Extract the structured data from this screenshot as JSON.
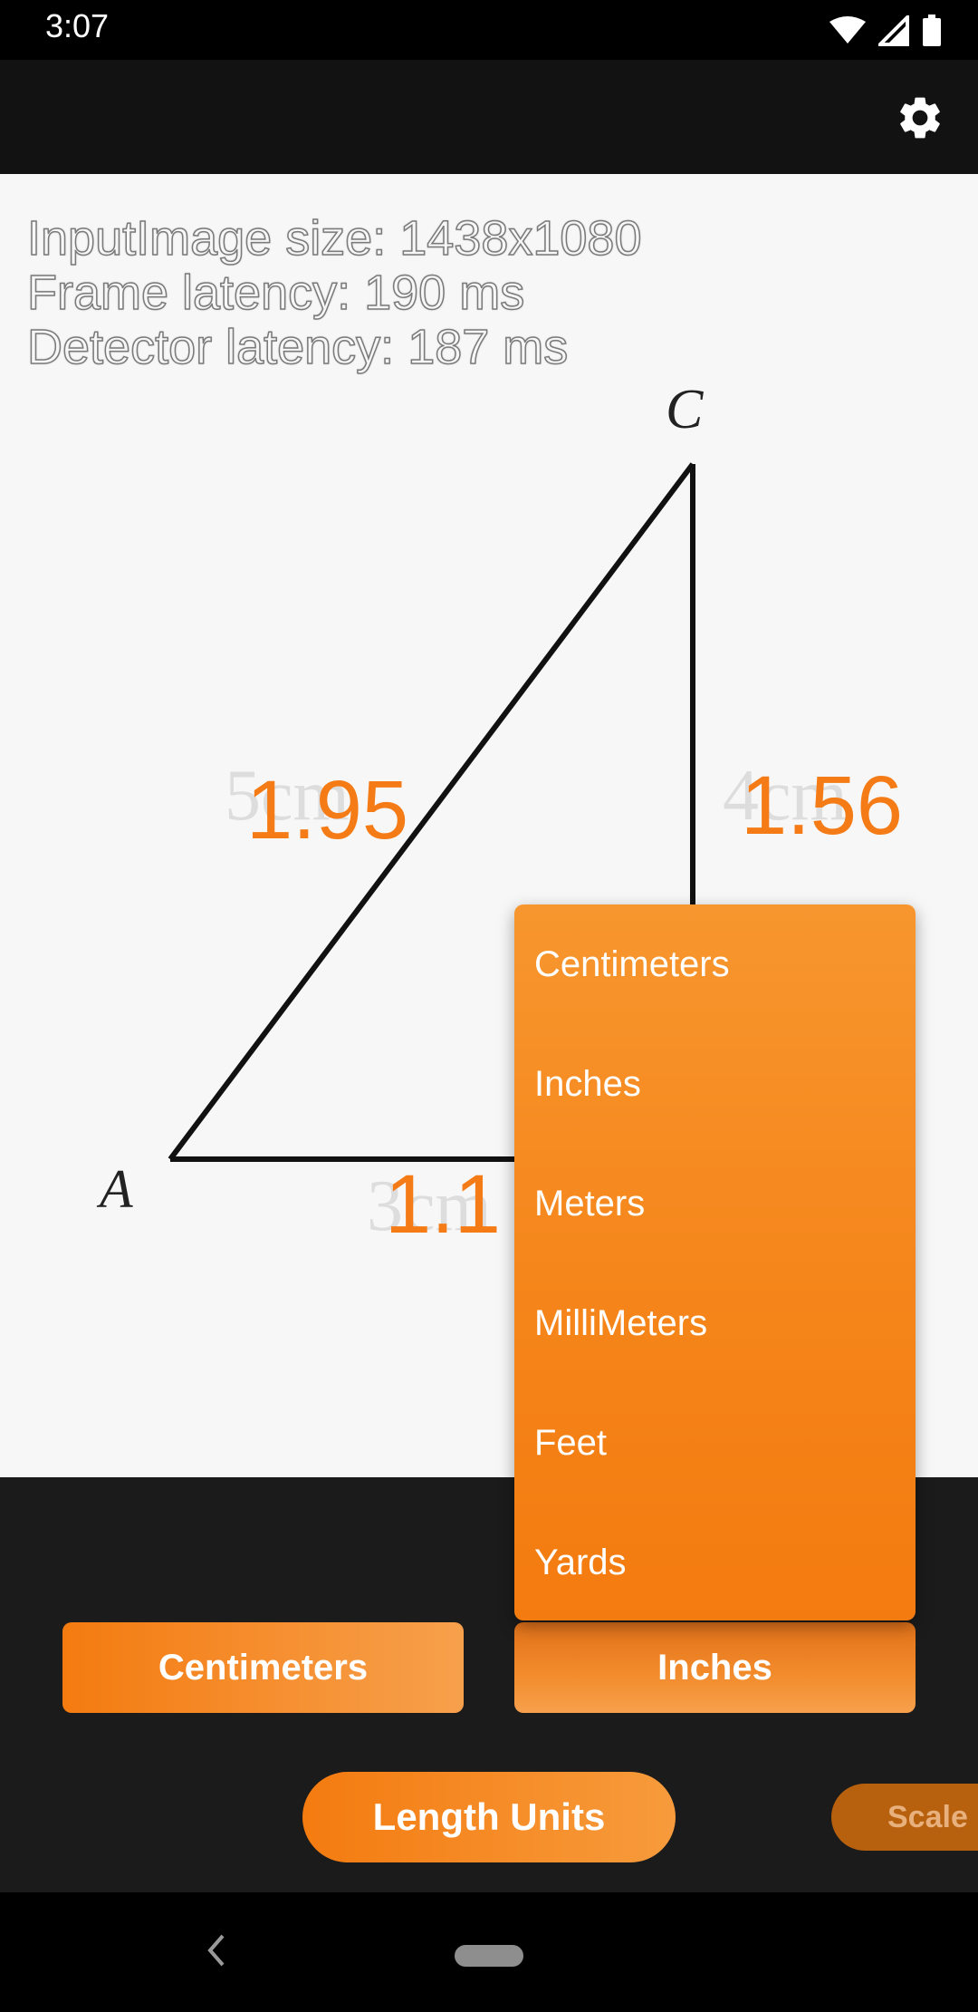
{
  "status_bar": {
    "time": "3:07"
  },
  "overlay": {
    "image_size": "InputImage size: 1438x1080",
    "frame_latency": "Frame latency: 190 ms",
    "detector_latency": "Detector latency: 187 ms"
  },
  "drawing": {
    "vertex_a": "A",
    "vertex_c": "C",
    "side_ac_printed": "5cm",
    "side_bc_printed": "4cm",
    "side_ab_printed": "3cm"
  },
  "measurements": {
    "hypotenuse": "1.95",
    "vertical": "1.56",
    "base": "1.1"
  },
  "unit_dropdown": {
    "options": [
      "Centimeters",
      "Inches",
      "Meters",
      "MilliMeters",
      "Feet",
      "Yards"
    ]
  },
  "buttons": {
    "from_unit": "Centimeters",
    "to_unit": "Inches",
    "length_units": "Length Units",
    "scale_units": "Scale U"
  },
  "colors": {
    "accent": "#f47b15",
    "background": "#1b1b1b"
  }
}
